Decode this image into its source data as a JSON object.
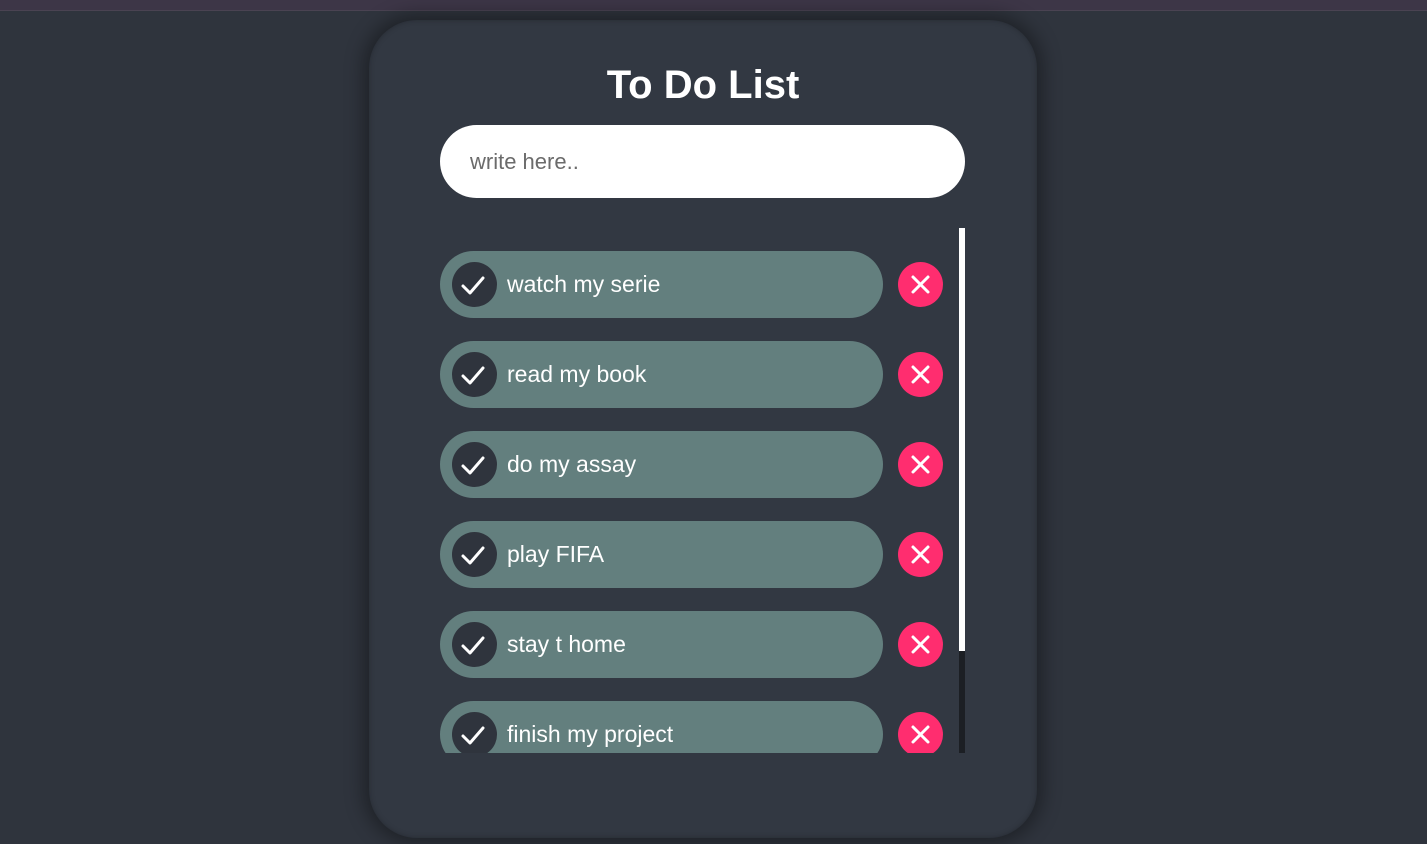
{
  "app": {
    "title": "To Do List"
  },
  "input": {
    "placeholder": "write here..",
    "value": ""
  },
  "tasks": [
    {
      "label": "watch my serie",
      "done": true
    },
    {
      "label": "read my book",
      "done": true
    },
    {
      "label": "do my assay",
      "done": true
    },
    {
      "label": "play FIFA",
      "done": true
    },
    {
      "label": "stay t home",
      "done": true
    },
    {
      "label": "finish my project",
      "done": true
    }
  ],
  "icons": {
    "check": "check-icon",
    "delete": "close-icon"
  },
  "colors": {
    "background": "#2f343d",
    "card": "#323842",
    "task_pill": "#637f7e",
    "check_circle": "#2f343d",
    "delete_button": "#ff2d6f",
    "text": "#ffffff"
  }
}
